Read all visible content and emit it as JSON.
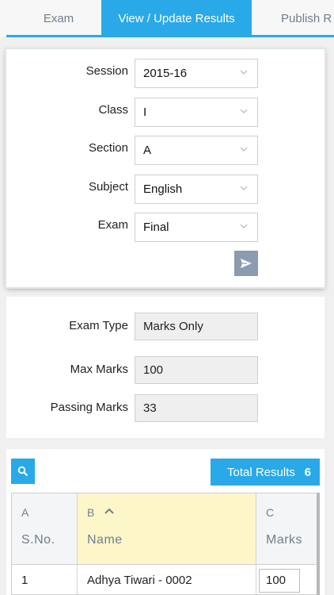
{
  "tabs": [
    {
      "label": "Exam",
      "active": false
    },
    {
      "label": "View / Update Results",
      "active": true
    },
    {
      "label": "Publish R",
      "active": false
    }
  ],
  "filters": {
    "session": {
      "label": "Session",
      "value": "2015-16"
    },
    "class": {
      "label": "Class",
      "value": "I"
    },
    "section": {
      "label": "Section",
      "value": "A"
    },
    "subject": {
      "label": "Subject",
      "value": "English"
    },
    "exam": {
      "label": "Exam",
      "value": "Final"
    },
    "submit_icon": "send-icon"
  },
  "exam_info": {
    "exam_type": {
      "label": "Exam Type",
      "value": "Marks Only"
    },
    "max_marks": {
      "label": "Max Marks",
      "value": "100"
    },
    "passing_marks": {
      "label": "Passing Marks",
      "value": "33"
    }
  },
  "results": {
    "search_icon": "search-icon",
    "total_label": "Total Results",
    "total_count": "6",
    "columns": [
      {
        "letter": "A",
        "name": "S.No."
      },
      {
        "letter": "B",
        "name": "Name",
        "sorted": "ascending"
      },
      {
        "letter": "C",
        "name": "Marks"
      }
    ],
    "rows": [
      {
        "sno": "1",
        "name": "Adhya Tiwari - 0002",
        "marks": "100"
      }
    ]
  },
  "colors": {
    "accent": "#29a9e8",
    "submit_button": "#8b9bb0",
    "sorted_column_header": "#fcf6c8"
  }
}
